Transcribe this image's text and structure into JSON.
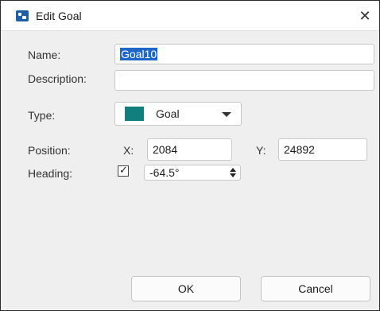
{
  "window": {
    "title": "Edit Goal",
    "close_glyph": "✕",
    "app_icon": "goal-dialog-icon"
  },
  "form": {
    "name": {
      "label": "Name:",
      "value": "Goal10"
    },
    "description": {
      "label": "Description:",
      "value": ""
    },
    "type": {
      "label": "Type:",
      "value": "Goal",
      "swatch_color": "#127f7f"
    },
    "position": {
      "label": "Position:",
      "x_label": "X:",
      "x_value": "2084",
      "y_label": "Y:",
      "y_value": "24892"
    },
    "heading": {
      "label": "Heading:",
      "enabled": true,
      "check_glyph": "✓",
      "value": "-64.5°"
    }
  },
  "buttons": {
    "ok": "OK",
    "cancel": "Cancel"
  }
}
